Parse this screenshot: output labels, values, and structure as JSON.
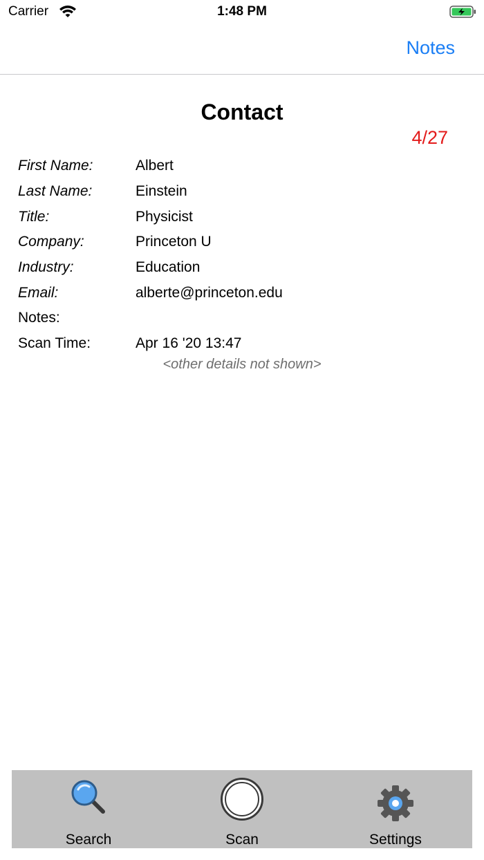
{
  "status_bar": {
    "carrier": "Carrier",
    "time": "1:48 PM",
    "wifi_icon": "wifi-icon",
    "battery_icon": "battery-charging-icon"
  },
  "nav_bar": {
    "notes_label": "Notes",
    "accent_color": "#1a7ef5"
  },
  "contact": {
    "title": "Contact",
    "counter": "4/27",
    "counter_color": "#e31b1b",
    "fields": [
      {
        "label": "First Name:",
        "value": "Albert"
      },
      {
        "label": "Last Name:",
        "value": "Einstein"
      },
      {
        "label": "Title:",
        "value": "Physicist"
      },
      {
        "label": "Company:",
        "value": "Princeton U"
      },
      {
        "label": "Industry:",
        "value": "Education"
      },
      {
        "label": "Email:",
        "value": "alberte@princeton.edu"
      },
      {
        "label": "Notes:",
        "value": ""
      },
      {
        "label": "Scan Time:",
        "value": "Apr 16 '20 13:47"
      }
    ],
    "other_details": "<other details not shown>"
  },
  "tab_bar": {
    "background": "#c0c0c0",
    "tabs": [
      {
        "label": "Search",
        "icon": "magnifier-icon"
      },
      {
        "label": "Scan",
        "icon": "scan-circle-icon"
      },
      {
        "label": "Settings",
        "icon": "gear-icon"
      }
    ]
  }
}
